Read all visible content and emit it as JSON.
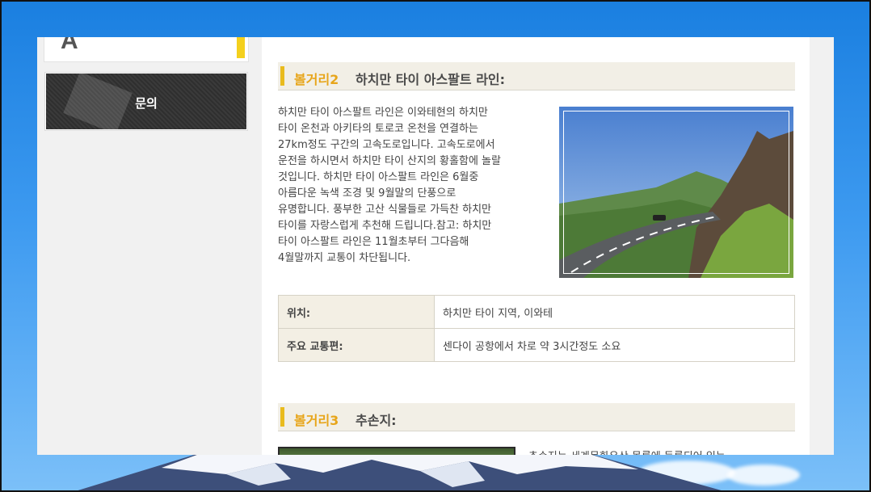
{
  "sidebar": {
    "top_card_text": "· · ·  · · ·",
    "inquiry_label": "문의"
  },
  "section2": {
    "number": "볼거리2",
    "title": "하치만 타이 아스팔트 라인:",
    "description_lines": [
      "하치만 타이 아스팔트 라인은 이와테현의 하치만",
      "타이 온천과 아키타의 토로코 온천을 연결하는",
      "27km정도 구간의 고속도로입니다. 고속도로에서",
      "운전을 하시면서 하치만 타이 산지의 황홀함에 놀랄",
      "것입니다. 하치만 타이 아스팔트 라인은 6월중",
      "아름다운 녹색 조경 및 9월말의 단풍으로",
      "유명합니다. 풍부한 고산 식물들로 가득찬 하치만",
      "타이를 자랑스럽게 추천해 드립니다.참고: 하치만",
      "타이 아스팔트 라인은 11월초부터 그다음해",
      "4월말까지 교통이 차단됩니다."
    ],
    "info": {
      "location_label": "위치:",
      "location_value": "하치만 타이 지역, 이와테",
      "transport_label": "주요 교통편:",
      "transport_value": "센다이 공항에서 차로 약 3시간정도 소요"
    }
  },
  "section3": {
    "number": "볼거리3",
    "title": "추손지:",
    "preview_text": "추손지는 세계문화유산 목록에 등록되어 있는"
  },
  "colors": {
    "accent_yellow": "#e9bb1d",
    "heading_bg": "#f2efe6",
    "number_orange": "#e7a51a"
  }
}
